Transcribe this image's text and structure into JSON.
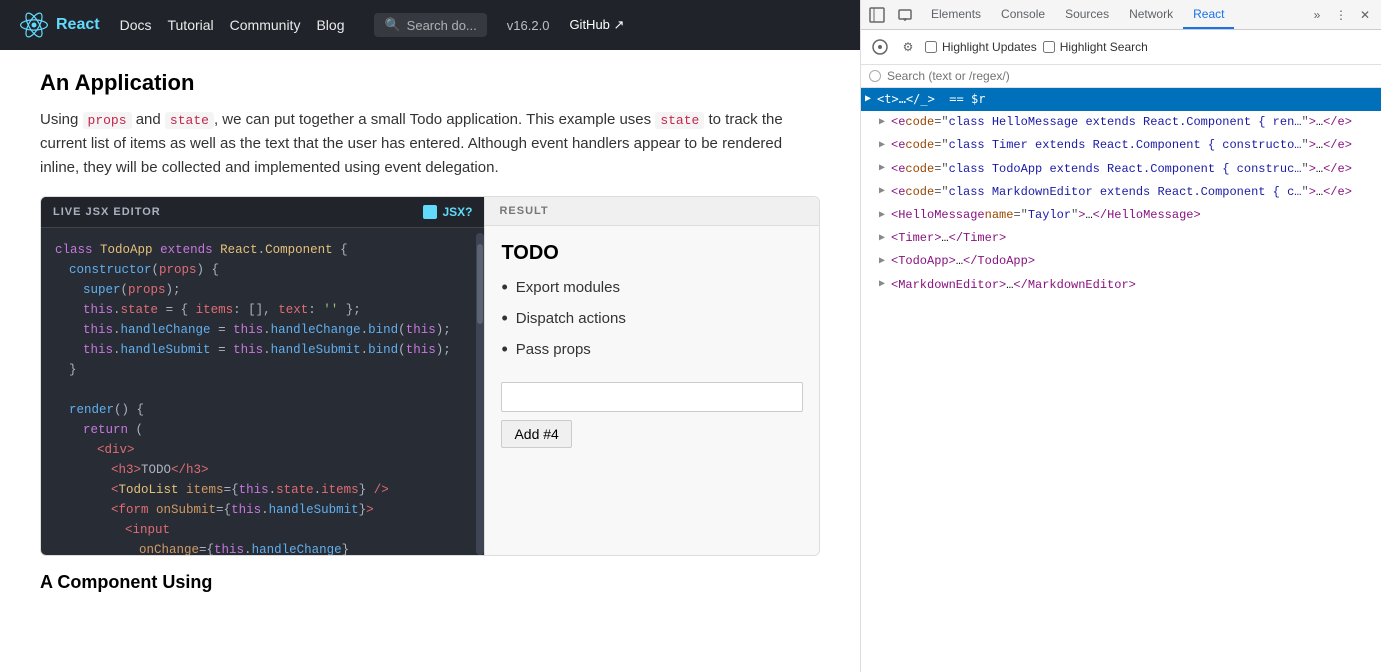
{
  "nav": {
    "logo": "React",
    "links": [
      "Docs",
      "Tutorial",
      "Community",
      "Blog"
    ],
    "search_placeholder": "Search do...",
    "version": "v16.2.0",
    "github": "GitHub ↗"
  },
  "content": {
    "heading": "An Application",
    "paragraph1": "Using props and state, we can put together a small Todo application. This example uses state to track the current list of items as well as the text that the user has entered. Although event handlers appear to be rendered inline, they will be collected and implemented using event delegation.",
    "editor": {
      "title": "LIVE JSX EDITOR",
      "jsx_label": "JSX?",
      "result_label": "RESULT",
      "code_lines": [
        "class TodoApp extends React.Component {",
        "  constructor(props) {",
        "    super(props);",
        "    this.state = { items: [], text: '' };",
        "    this.handleChange = this.handleChange.bind(this);",
        "    this.handleSubmit = this.handleSubmit.bind(this);",
        "  }",
        "",
        "  render() {",
        "    return (",
        "      <div>",
        "        <h3>TODO</h3>",
        "        <TodoList items={this.state.items} />",
        "        <form onSubmit={this.handleSubmit}>",
        "          <input",
        "            onChange={this.handleChange}"
      ]
    },
    "result": {
      "title": "TODO",
      "items": [
        "Export modules",
        "Dispatch actions",
        "Pass props"
      ],
      "button_label": "Add #4"
    }
  },
  "devtools": {
    "tabs": [
      "Elements",
      "Console",
      "Sources",
      "Network",
      "React"
    ],
    "active_tab": "React",
    "icons": {
      "cursor": "⊡",
      "device": "▭",
      "more": "⋮",
      "close": "✕",
      "overflow": "»"
    },
    "react_bar": {
      "inspect_icon": "◎",
      "settings_icon": "⚙",
      "highlight_updates_label": "Highlight Updates",
      "highlight_search_label": "Highlight Search"
    },
    "search": {
      "placeholder": "Search (text or /regex/)"
    },
    "tree": [
      {
        "indent": 0,
        "arrow": "▶",
        "selected": true,
        "content": "<t>…</_> == $r"
      },
      {
        "indent": 1,
        "arrow": "▶",
        "selected": false,
        "content": "<e code=\"class HelloMessage extends React.Component { ren…\">…</e>"
      },
      {
        "indent": 1,
        "arrow": "▶",
        "selected": false,
        "content": "<e code=\"class Timer extends React.Component { constructo…\">…</e>"
      },
      {
        "indent": 1,
        "arrow": "▶",
        "selected": false,
        "content": "<e code=\"class TodoApp extends React.Component { construc…\">…</e>"
      },
      {
        "indent": 1,
        "arrow": "▶",
        "selected": false,
        "content": "<e code=\"class MarkdownEditor extends React.Component { c…\">…</e>"
      },
      {
        "indent": 1,
        "arrow": "▶",
        "selected": false,
        "content": "<HelloMessage name=\"Taylor\">…</HelloMessage>"
      },
      {
        "indent": 1,
        "arrow": "▶",
        "selected": false,
        "content": "<Timer>…</Timer>"
      },
      {
        "indent": 1,
        "arrow": "▶",
        "selected": false,
        "content": "<TodoApp>…</TodoApp>"
      },
      {
        "indent": 1,
        "arrow": "▶",
        "selected": false,
        "content": "<MarkdownEditor>…</MarkdownEditor>"
      }
    ]
  }
}
